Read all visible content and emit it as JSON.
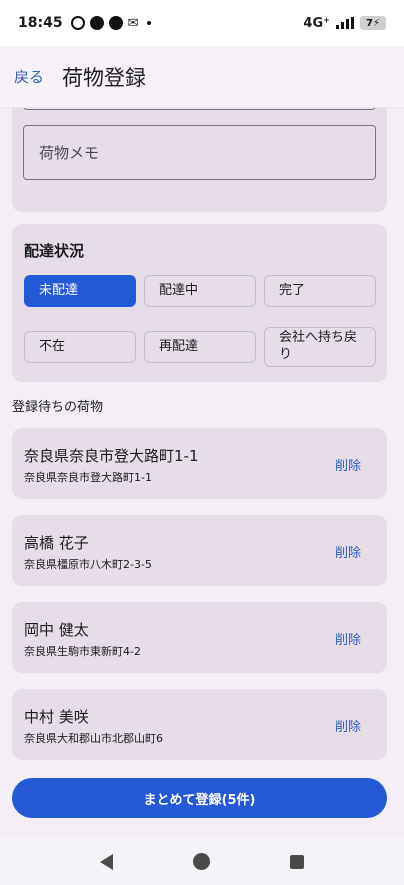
{
  "status_bar": {
    "time": "18:45",
    "network": "4G⁺",
    "battery": "7"
  },
  "app_bar": {
    "back_label": "戻る",
    "title": "荷物登録"
  },
  "memo": {
    "placeholder": "荷物メモ"
  },
  "delivery_status": {
    "title": "配達状況",
    "options": [
      "未配達",
      "配達中",
      "完了",
      "不在",
      "再配達",
      "会社へ持ち戻り"
    ],
    "selected": "未配達"
  },
  "pending": {
    "heading": "登録待ちの荷物",
    "delete_label": "削除",
    "items": [
      {
        "name": "奈良県奈良市登大路町1-1",
        "address": "奈良県奈良市登大路町1-1"
      },
      {
        "name": "高橋 花子",
        "address": "奈良県橿原市八木町2-3-5"
      },
      {
        "name": "岡中 健太",
        "address": "奈良県生駒市東新町4-2"
      },
      {
        "name": "中村 美咲",
        "address": "奈良県大和郡山市北郡山町6"
      }
    ]
  },
  "submit_label": "まとめて登録(5件)",
  "colors": {
    "accent": "#2459d6",
    "link": "#2f5dba",
    "card": "#e6dde9",
    "background": "#f4eff7"
  }
}
